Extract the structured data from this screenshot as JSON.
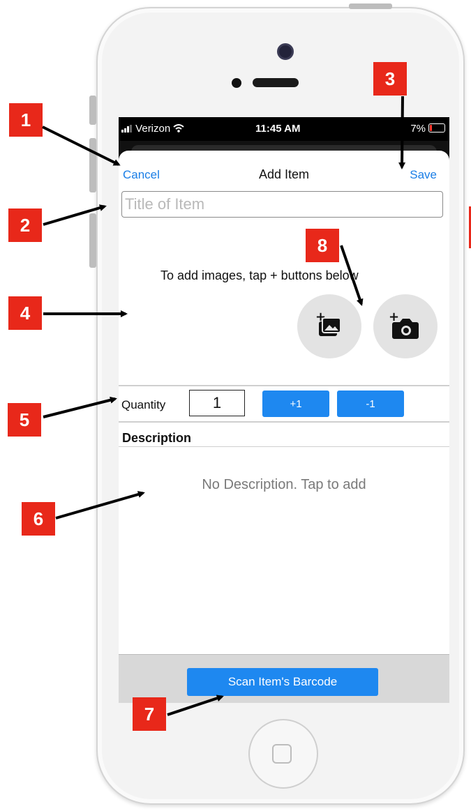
{
  "status_bar": {
    "carrier": "Verizon",
    "time": "11:45 AM",
    "battery": "7%"
  },
  "nav": {
    "cancel": "Cancel",
    "title": "Add Item",
    "save": "Save"
  },
  "title_field": {
    "placeholder": "Title of Item",
    "value": ""
  },
  "images": {
    "hint": "To add images, tap + buttons below",
    "buttons": [
      "add-photo-from-library-icon",
      "take-photo-camera-icon"
    ]
  },
  "quantity": {
    "label": "Quantity",
    "value": "1",
    "increment_label": "+1",
    "decrement_label": "-1"
  },
  "description": {
    "header": "Description",
    "placeholder": "No Description. Tap to add"
  },
  "bottom": {
    "scan_label": "Scan Item's Barcode"
  },
  "callouts": [
    "1",
    "2",
    "3",
    "4",
    "5",
    "6",
    "7",
    "8"
  ],
  "colors": {
    "accent": "#1e88f0",
    "link": "#1a7ee6",
    "callout": "#e8281a"
  }
}
